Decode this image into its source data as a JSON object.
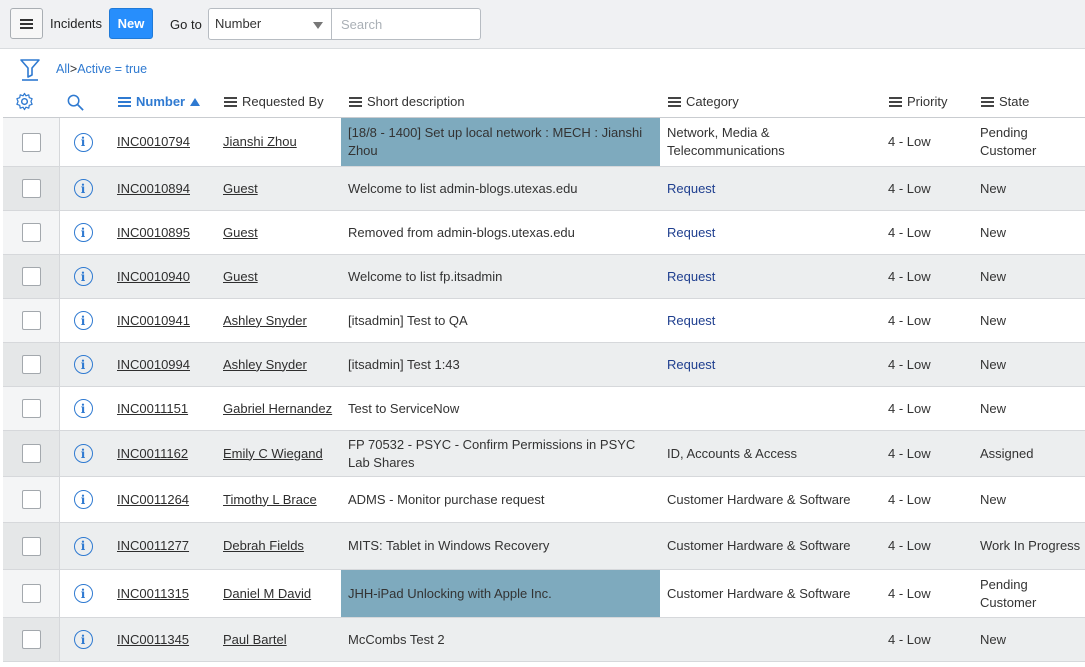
{
  "header": {
    "title": "Incidents",
    "new_label": "New",
    "goto_label": "Go to",
    "goto_field": "Number",
    "search_placeholder": "Search"
  },
  "breadcrumb": {
    "all": "All",
    "separator": ">",
    "filter": "Active = true"
  },
  "columns": {
    "number": "Number",
    "requested_by": "Requested By",
    "short_description": "Short description",
    "category": "Category",
    "priority": "Priority",
    "state": "State"
  },
  "colors": {
    "accent": "#278efc",
    "highlight": "#7eaabe",
    "link": "#2f7ad1"
  },
  "rows": [
    {
      "number": "INC0010794",
      "requested_by": "Jianshi Zhou",
      "description": "[18/8 - 1400] Set up local network : MECH : Jianshi Zhou",
      "category": "Network, Media & Telecommunications",
      "priority": "4 - Low",
      "state": "Pending Customer",
      "highlight": true,
      "category_link": false
    },
    {
      "number": "INC0010894",
      "requested_by": "Guest",
      "description": "Welcome to list admin-blogs.utexas.edu",
      "category": "Request",
      "priority": "4 - Low",
      "state": "New",
      "highlight": false,
      "category_link": true
    },
    {
      "number": "INC0010895",
      "requested_by": "Guest",
      "description": "Removed from admin-blogs.utexas.edu",
      "category": "Request",
      "priority": "4 - Low",
      "state": "New",
      "highlight": false,
      "category_link": true
    },
    {
      "number": "INC0010940",
      "requested_by": "Guest",
      "description": "Welcome to list fp.itsadmin",
      "category": "Request",
      "priority": "4 - Low",
      "state": "New",
      "highlight": false,
      "category_link": true
    },
    {
      "number": "INC0010941",
      "requested_by": "Ashley Snyder",
      "description": "[itsadmin] Test to QA",
      "category": "Request",
      "priority": "4 - Low",
      "state": "New",
      "highlight": false,
      "category_link": true
    },
    {
      "number": "INC0010994",
      "requested_by": "Ashley Snyder",
      "description": "[itsadmin] Test 1:43",
      "category": "Request",
      "priority": "4 - Low",
      "state": "New",
      "highlight": false,
      "category_link": true
    },
    {
      "number": "INC0011151",
      "requested_by": "Gabriel Hernandez",
      "description": "Test to ServiceNow",
      "category": "",
      "priority": "4 - Low",
      "state": "New",
      "highlight": false,
      "category_link": false
    },
    {
      "number": "INC0011162",
      "requested_by": "Emily C Wiegand",
      "description": "FP 70532 - PSYC - Confirm Permissions in PSYC Lab Shares",
      "category": "ID, Accounts & Access",
      "priority": "4 - Low",
      "state": "Assigned",
      "highlight": false,
      "category_link": false
    },
    {
      "number": "INC0011264",
      "requested_by": "Timothy L Brace",
      "description": "ADMS - Monitor purchase request",
      "category": "Customer Hardware & Software",
      "priority": "4 - Low",
      "state": "New",
      "highlight": false,
      "category_link": false
    },
    {
      "number": "INC0011277",
      "requested_by": "Debrah Fields",
      "description": "MITS: Tablet in Windows Recovery",
      "category": "Customer Hardware & Software",
      "priority": "4 - Low",
      "state": "Work In Progress",
      "highlight": false,
      "category_link": false
    },
    {
      "number": "INC0011315",
      "requested_by": "Daniel M David",
      "description": "JHH-iPad Unlocking with Apple Inc.",
      "category": "Customer Hardware & Software",
      "priority": "4 - Low",
      "state": "Pending Customer",
      "highlight": true,
      "category_link": false
    },
    {
      "number": "INC0011345",
      "requested_by": "Paul Bartel",
      "description": "McCombs Test 2",
      "category": "",
      "priority": "4 - Low",
      "state": "New",
      "highlight": false,
      "category_link": false
    }
  ]
}
